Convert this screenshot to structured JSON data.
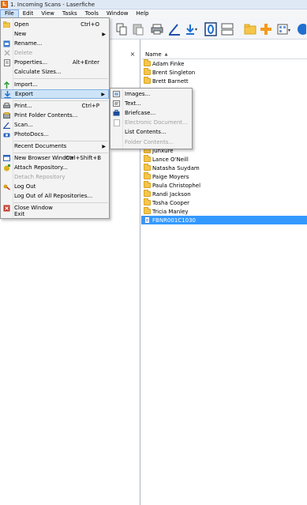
{
  "window": {
    "title": "1. Incoming Scans - Laserfiche",
    "app_icon_letter": "L"
  },
  "menubar": [
    "File",
    "Edit",
    "View",
    "Tasks",
    "Tools",
    "Window",
    "Help"
  ],
  "file_menu": [
    {
      "label": "Open",
      "shortcut": "Ctrl+O",
      "icon": "folder-open-icon"
    },
    {
      "label": "New",
      "submenu": true
    },
    {
      "label": "Rename...",
      "icon": "rename-icon"
    },
    {
      "label": "Delete",
      "disabled": true,
      "icon": "delete-icon"
    },
    {
      "label": "Properties...",
      "shortcut": "Alt+Enter",
      "icon": "properties-icon"
    },
    {
      "label": "Calculate Sizes..."
    },
    {
      "label": "Import...",
      "icon": "import-icon"
    },
    {
      "label": "Export",
      "submenu": true,
      "icon": "export-icon",
      "highlighted": true
    },
    {
      "label": "Print...",
      "shortcut": "Ctrl+P",
      "icon": "print-icon"
    },
    {
      "label": "Print Folder Contents...",
      "icon": "print-folder-icon"
    },
    {
      "label": "Scan...",
      "icon": "scan-icon"
    },
    {
      "label": "PhotoDocs...",
      "icon": "camera-icon"
    },
    {
      "label": "Recent Documents",
      "submenu": true
    },
    {
      "label": "New Browser Window",
      "shortcut": "Ctrl+Shift+B",
      "icon": "new-window-icon"
    },
    {
      "label": "Attach Repository...",
      "icon": "attach-repository-icon"
    },
    {
      "label": "Detach Repository",
      "disabled": true
    },
    {
      "label": "Log Out",
      "icon": "log-out-icon"
    },
    {
      "label": "Log Out of All Repositories..."
    },
    {
      "label": "Close Window",
      "icon": "close-window-icon"
    },
    {
      "label": "Exit"
    }
  ],
  "export_submenu": [
    {
      "label": "Images...",
      "icon": "images-icon"
    },
    {
      "label": "Text...",
      "icon": "text-icon"
    },
    {
      "label": "Briefcase...",
      "icon": "briefcase-icon"
    },
    {
      "label": "Electronic Document...",
      "disabled": true,
      "icon": "electronic-document-icon"
    },
    {
      "label": "List Contents..."
    },
    {
      "label": "Folder Contents...",
      "disabled": true
    }
  ],
  "left_pane": {
    "close_glyph": "×"
  },
  "list": {
    "column_header": "Name",
    "sort_glyph": "▲",
    "entries": [
      {
        "name": "Adam Finke",
        "type": "folder"
      },
      {
        "name": "Brent Singleton",
        "type": "folder"
      },
      {
        "name": "Brett Barnett",
        "type": "folder"
      },
      {
        "name": "Jordan Ellis",
        "type": "folder"
      },
      {
        "name": "Junxure",
        "type": "folder"
      },
      {
        "name": "Lance O'Neill",
        "type": "folder"
      },
      {
        "name": "Natasha Suydam",
        "type": "folder"
      },
      {
        "name": "Paige Moyers",
        "type": "folder"
      },
      {
        "name": "Paula Christophel",
        "type": "folder"
      },
      {
        "name": "Randi Jackson",
        "type": "folder"
      },
      {
        "name": "Tosha Cooper",
        "type": "folder"
      },
      {
        "name": "Tricia Manley",
        "type": "folder"
      },
      {
        "name": "FBNR001C1030",
        "type": "document",
        "selected": true
      }
    ]
  },
  "colors": {
    "selection": "#3399ff",
    "menu_hover": "#cde3f7",
    "folder": "#f6c64a"
  }
}
